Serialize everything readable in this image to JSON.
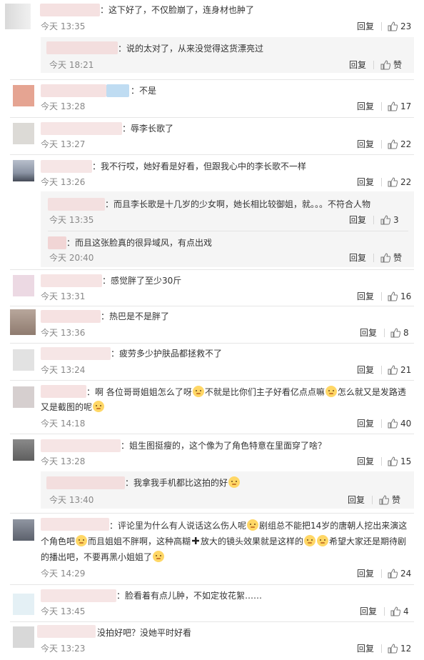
{
  "ui": {
    "reply_label": "回复",
    "like_zero_label": "赞"
  },
  "comments": [
    {
      "text": "：这下好了，不仅脸崩了，连身材也肿了",
      "time": "今天 13:35",
      "likes": "23"
    },
    {
      "text": "：说的太对了，从来没觉得这货漂亮过",
      "time": "今天 18:21",
      "likes": "赞"
    },
    {
      "text": "：不是",
      "time": "今天 13:28",
      "likes": "17"
    },
    {
      "text": "：辱李长歌了",
      "time": "今天 13:27",
      "likes": "22"
    },
    {
      "text": "：我不行哎，她好看是好看，但跟我心中的李长歌不一样",
      "time": "今天 13:26",
      "likes": "22"
    },
    {
      "text": "：而且李长歌是十几岁的少女啊，她长相比较御姐，就。。。不符合人物",
      "time": "今天 13:35",
      "likes": "3"
    },
    {
      "text": "：而且这张脸真的很异域风，有点出戏",
      "time": "今天 20:40",
      "likes": "赞"
    },
    {
      "text": "：感觉胖了至少30斤",
      "time": "今天 13:31",
      "likes": "16"
    },
    {
      "text": "：热巴是不是胖了",
      "time": "今天 13:36",
      "likes": "8"
    },
    {
      "text": "：疲劳多少护肤品都拯救不了",
      "time": "今天 13:24",
      "likes": "21"
    },
    {
      "text_parts": [
        "：啊 各位哥哥姐姐怎么了呀",
        "不就是比你们主子好看亿点点嘛",
        "怎么就又是发路透",
        "又是截图的呢"
      ],
      "time": "今天 14:18",
      "likes": "40"
    },
    {
      "text": "：姐生图挺瘦的，这个像为了角色特意在里面穿了啥？",
      "time": "今天 13:28",
      "likes": "15"
    },
    {
      "text": "：我拿我手机都比这拍的好",
      "time": "今天 13:40",
      "likes": "赞"
    },
    {
      "text_parts": [
        "：评论里为什么有人说话这么伤人呢",
        "剧组总不能把14岁的唐朝人挖出来演这",
        "个角色吧",
        "而且姐姐不胖啊，这种高糊",
        "放大的镜头效果就是这样的",
        "希望大家还是期待剧",
        "的播出吧，不要再黑小姐姐了"
      ],
      "time": "今天 14:29",
      "likes": "24"
    },
    {
      "text": "：脸看着有点儿肿，不如定妆花絮……",
      "time": "今天 13:45",
      "likes": "4"
    },
    {
      "text": "没拍好吧？没她平时好看",
      "time": "今天 13:23",
      "likes": "12"
    }
  ]
}
